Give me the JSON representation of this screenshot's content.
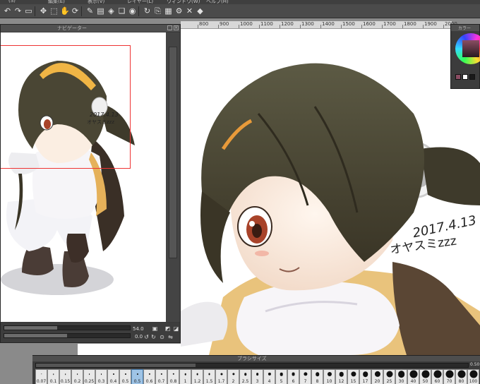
{
  "menu": {
    "items": [
      "(S)",
      "編集(E)",
      "表示(V)",
      "レイヤー(L)",
      "ウィンドウ(W)",
      "ヘルプ(H)"
    ]
  },
  "toolbar": {
    "icons": [
      "undo-icon",
      "redo-icon",
      "clear-icon",
      "move-icon",
      "transform-icon",
      "hand-icon",
      "rotate-icon",
      "pen-icon",
      "ruler-icon",
      "snap-icon",
      "layer-icon",
      "eye-icon",
      "refresh-icon",
      "clip-icon",
      "grid-icon",
      "gear-icon",
      "close-icon",
      "fill-icon"
    ]
  },
  "ruler": {
    "labels": [
      "800",
      "900",
      "1000",
      "1100",
      "1200",
      "1300",
      "1400",
      "1500",
      "1600",
      "1700",
      "1800",
      "1900",
      "2000"
    ]
  },
  "navigator": {
    "title": "ナビゲーター",
    "zoom": "54.0",
    "angle": "0.0",
    "zoom_fill": 0.42,
    "angle_fill": 0.5
  },
  "color_panel": {
    "title": "カラー",
    "swatches": [
      "#8a4d62",
      "#ffffff",
      "#1a1a1a"
    ]
  },
  "canvas": {
    "signature_date": "2017.4.13",
    "signature_text": "オヤスミzzz"
  },
  "brush_panel": {
    "title": "ブラシサイズ",
    "size_readout": "0.50",
    "selected_index": 8,
    "slider_fill": 0.37,
    "sizes": [
      "0.07",
      "0.1",
      "0.15",
      "0.2",
      "0.25",
      "0.3",
      "0.4",
      "0.5",
      "0.5",
      "0.6",
      "0.7",
      "0.8",
      "1",
      "1.2",
      "1.5",
      "1.7",
      "2",
      "2.5",
      "3",
      "4",
      "5",
      "6",
      "7",
      "8",
      "10",
      "12",
      "15",
      "17",
      "20",
      "25",
      "30",
      "40",
      "50",
      "60",
      "70",
      "80",
      "100"
    ]
  }
}
